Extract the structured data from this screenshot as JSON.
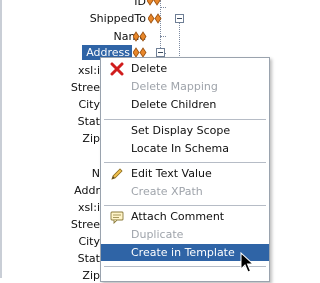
{
  "tree": {
    "nodes": [
      {
        "id": "node-id",
        "label": "ID",
        "indicator": true,
        "expander": false
      },
      {
        "id": "node-shippedto",
        "label": "ShippedTo",
        "indicator": true,
        "expander": true
      },
      {
        "id": "node-name",
        "label": "Name",
        "indicator": true,
        "expander": false
      },
      {
        "id": "node-address",
        "label": "Address",
        "indicator": true,
        "expander": true,
        "selected": true
      },
      {
        "id": "node-xsi-1",
        "label": "xsl:i"
      },
      {
        "id": "node-street-1",
        "label": "Stree"
      },
      {
        "id": "node-city-1",
        "label": "City"
      },
      {
        "id": "node-state-1",
        "label": "Stat"
      },
      {
        "id": "node-zip-1",
        "label": "Zip"
      },
      {
        "id": "node-n",
        "label": "N"
      },
      {
        "id": "node-addr-2",
        "label": "Addr"
      },
      {
        "id": "node-xsi-2",
        "label": "xsl:i"
      },
      {
        "id": "node-street-2",
        "label": "Stree"
      },
      {
        "id": "node-city-2",
        "label": "City"
      },
      {
        "id": "node-state-2",
        "label": "Stat"
      },
      {
        "id": "node-zip-2",
        "label": "Zip"
      }
    ]
  },
  "context_menu": {
    "items": [
      {
        "key": "delete",
        "label": "Delete",
        "enabled": true,
        "icon": "delete-x-icon"
      },
      {
        "key": "delete_mapping",
        "label": "Delete Mapping",
        "enabled": false
      },
      {
        "key": "delete_children",
        "label": "Delete Children",
        "enabled": true
      },
      {
        "key": "set_display_scope",
        "label": "Set Display Scope",
        "enabled": true
      },
      {
        "key": "locate_in_schema",
        "label": "Locate In Schema",
        "enabled": true
      },
      {
        "key": "edit_text_value",
        "label": "Edit Text Value",
        "enabled": true,
        "icon": "pencil-icon"
      },
      {
        "key": "create_xpath",
        "label": "Create XPath",
        "enabled": false
      },
      {
        "key": "attach_comment",
        "label": "Attach Comment",
        "enabled": true,
        "icon": "comment-icon"
      },
      {
        "key": "duplicate",
        "label": "Duplicate",
        "enabled": false
      },
      {
        "key": "create_in_template",
        "label": "Create in Template",
        "enabled": true,
        "highlighted": true
      }
    ]
  },
  "colors": {
    "selection": "#2f64a6",
    "indicator": "#e8872a",
    "disabled_text": "#9ea3aa",
    "delete_icon": "#d01d1d"
  }
}
